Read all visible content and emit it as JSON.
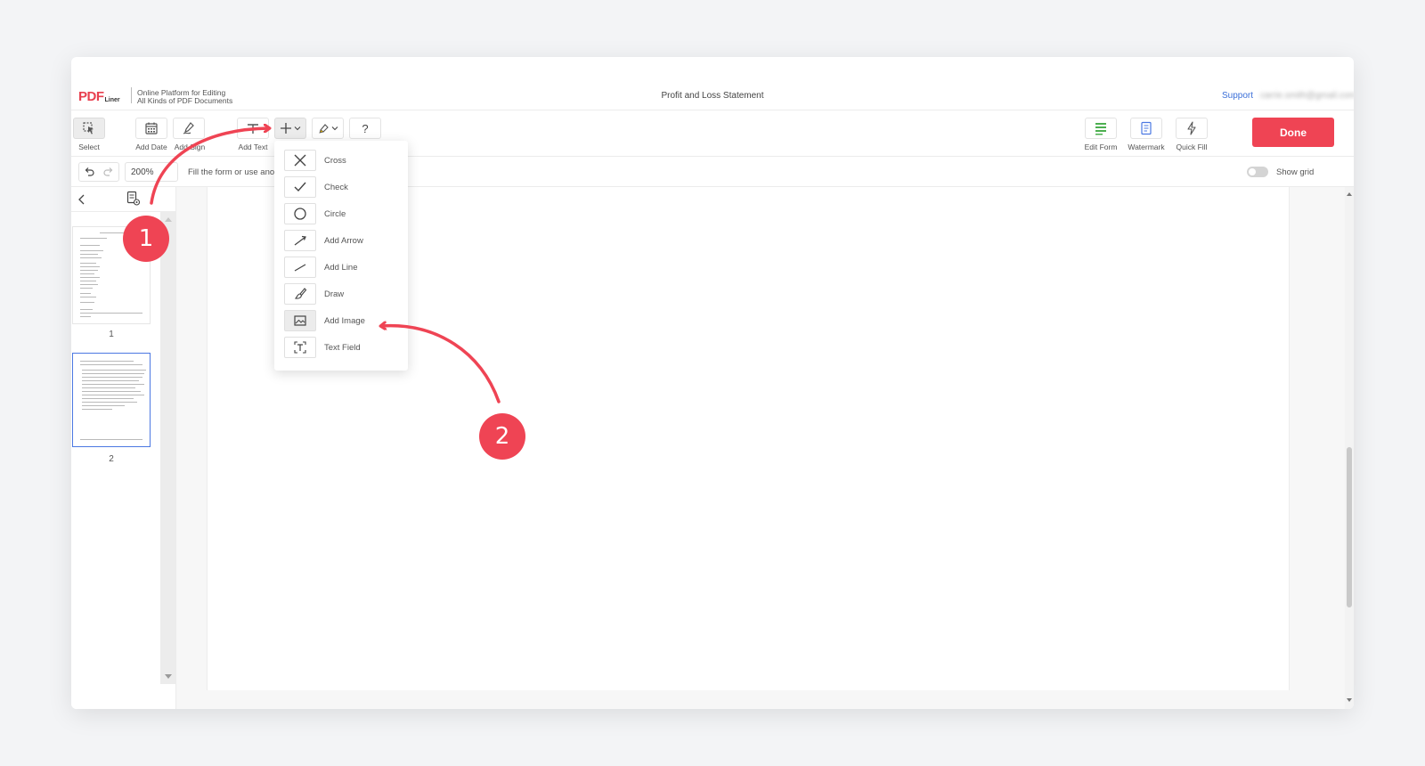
{
  "header": {
    "logo_pdf": "PDF",
    "logo_liner": "Liner",
    "tagline_line1": "Online Platform for Editing",
    "tagline_line2": "All Kinds of PDF Documents",
    "doc_title": "Profit and Loss Statement",
    "support_label": "Support",
    "user_email": "carrie.smith@gmail.com"
  },
  "toolbar": {
    "select_label": "Select",
    "add_date_label": "Add Date",
    "add_sign_label": "Add Sign",
    "add_text_label": "Add Text",
    "help_symbol": "?",
    "edit_form_label": "Edit Form",
    "watermark_label": "Watermark",
    "quick_fill_label": "Quick Fill",
    "done_label": "Done"
  },
  "subbar": {
    "zoom_value": "200%",
    "hint_text": "Fill the form or use ano",
    "show_grid_label": "Show grid",
    "show_grid_on": false
  },
  "sidebar": {
    "pages": [
      {
        "number": "1",
        "selected": false
      },
      {
        "number": "2",
        "selected": true
      }
    ]
  },
  "insert_menu": {
    "items": [
      {
        "label": "Cross",
        "icon": "cross-icon"
      },
      {
        "label": "Check",
        "icon": "check-icon"
      },
      {
        "label": "Circle",
        "icon": "circle-icon"
      },
      {
        "label": "Add Arrow",
        "icon": "arrow-icon"
      },
      {
        "label": "Add Line",
        "icon": "line-icon"
      },
      {
        "label": "Draw",
        "icon": "brush-icon"
      },
      {
        "label": "Add Image",
        "icon": "image-icon",
        "highlighted": true
      },
      {
        "label": "Text Field",
        "icon": "text-field-icon"
      }
    ]
  },
  "annotations": {
    "step1": "1",
    "step2": "2",
    "color": "#ef4454"
  },
  "colors": {
    "accent": "#ef4454",
    "link": "#3b6fd8",
    "selection": "#4b78e2"
  }
}
